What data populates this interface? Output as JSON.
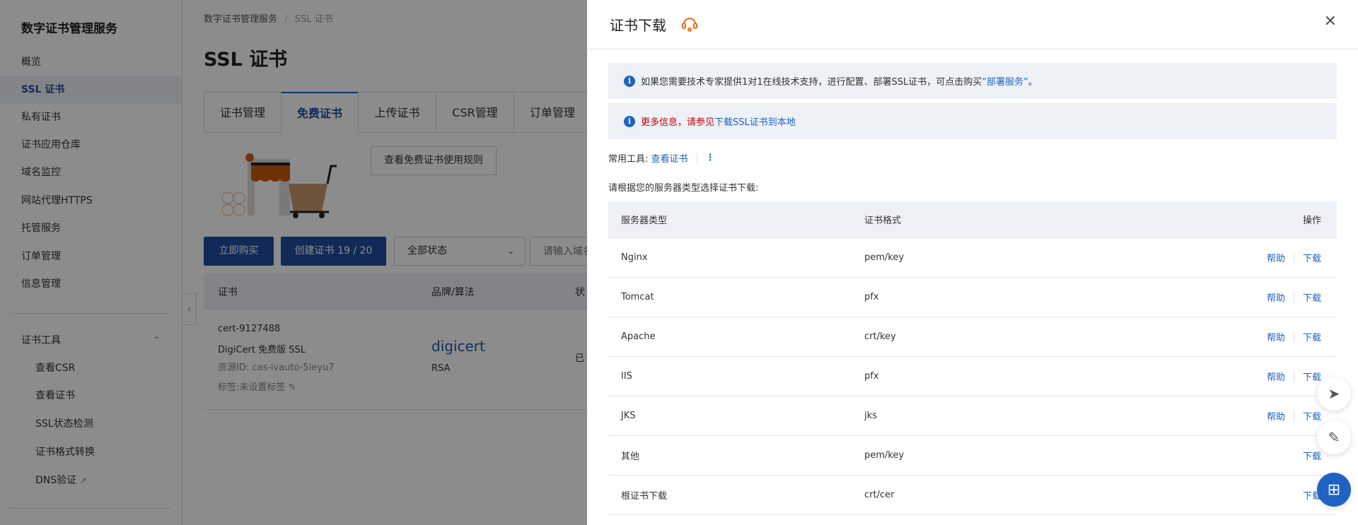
{
  "sidebar": {
    "title": "数字证书管理服务",
    "items": [
      {
        "label": "概览"
      },
      {
        "label": "SSL 证书"
      },
      {
        "label": "私有证书"
      },
      {
        "label": "证书应用仓库"
      },
      {
        "label": "域名监控"
      },
      {
        "label": "网站代理HTTPS"
      },
      {
        "label": "托管服务"
      },
      {
        "label": "订单管理"
      },
      {
        "label": "信息管理"
      }
    ],
    "tools_group": "证书工具",
    "tools": [
      {
        "label": "查看CSR"
      },
      {
        "label": "查看证书"
      },
      {
        "label": "SSL状态检测"
      },
      {
        "label": "证书格式转换"
      },
      {
        "label": "DNS验证"
      }
    ]
  },
  "main": {
    "breadcrumb": [
      "数字证书管理服务",
      "/",
      "SSL 证书"
    ],
    "title": "SSL 证书",
    "tabs": [
      {
        "label": "证书管理"
      },
      {
        "label": "免费证书"
      },
      {
        "label": "上传证书"
      },
      {
        "label": "CSR管理"
      },
      {
        "label": "订单管理"
      }
    ],
    "rules_button": "查看免费证书使用规则",
    "buy_button": "立即购买",
    "create_button": "创建证书 19 / 20",
    "status_select": "全部状态",
    "search_placeholder": "请输入域名",
    "table": {
      "headers": [
        "证书",
        "品牌/算法",
        "状"
      ],
      "row": {
        "name": "cert-9127488",
        "product": "DigiCert 免费版 SSL",
        "resource_id": "资源ID: cas-ivauto-5ieyu7",
        "tag": "标签:未设置标签",
        "brand": "digicert",
        "algo": "RSA",
        "status": "已"
      }
    }
  },
  "drawer": {
    "title": "证书下载",
    "info1": {
      "text": "如果您需要技术专家提供1对1在线技术支持，进行配置、部署SSL证书，可点击购买",
      "link": "“部署服务”",
      "end": "。"
    },
    "info2": {
      "text": "更多信息，请参见",
      "link": "下载SSL证书到本地"
    },
    "tools_label": "常用工具:",
    "tools_link": "查看证书",
    "prompt": "请根据您的服务器类型选择证书下载:",
    "headers": [
      "服务器类型",
      "证书格式",
      "操作"
    ],
    "help": "帮助",
    "download": "下载",
    "rows": [
      {
        "server": "Nginx",
        "format": "pem/key"
      },
      {
        "server": "Tomcat",
        "format": "pfx"
      },
      {
        "server": "Apache",
        "format": "crt/key"
      },
      {
        "server": "IIS",
        "format": "pfx"
      },
      {
        "server": "JKS",
        "format": "jks"
      },
      {
        "server": "其他",
        "format": "pem/key"
      },
      {
        "server": "根证书下载",
        "format": "crt/cer"
      }
    ]
  },
  "colors": {
    "primary": "#1f4e9e",
    "link": "#1f62c4",
    "warn": "#c7000b",
    "accent": "#f06a0f"
  }
}
